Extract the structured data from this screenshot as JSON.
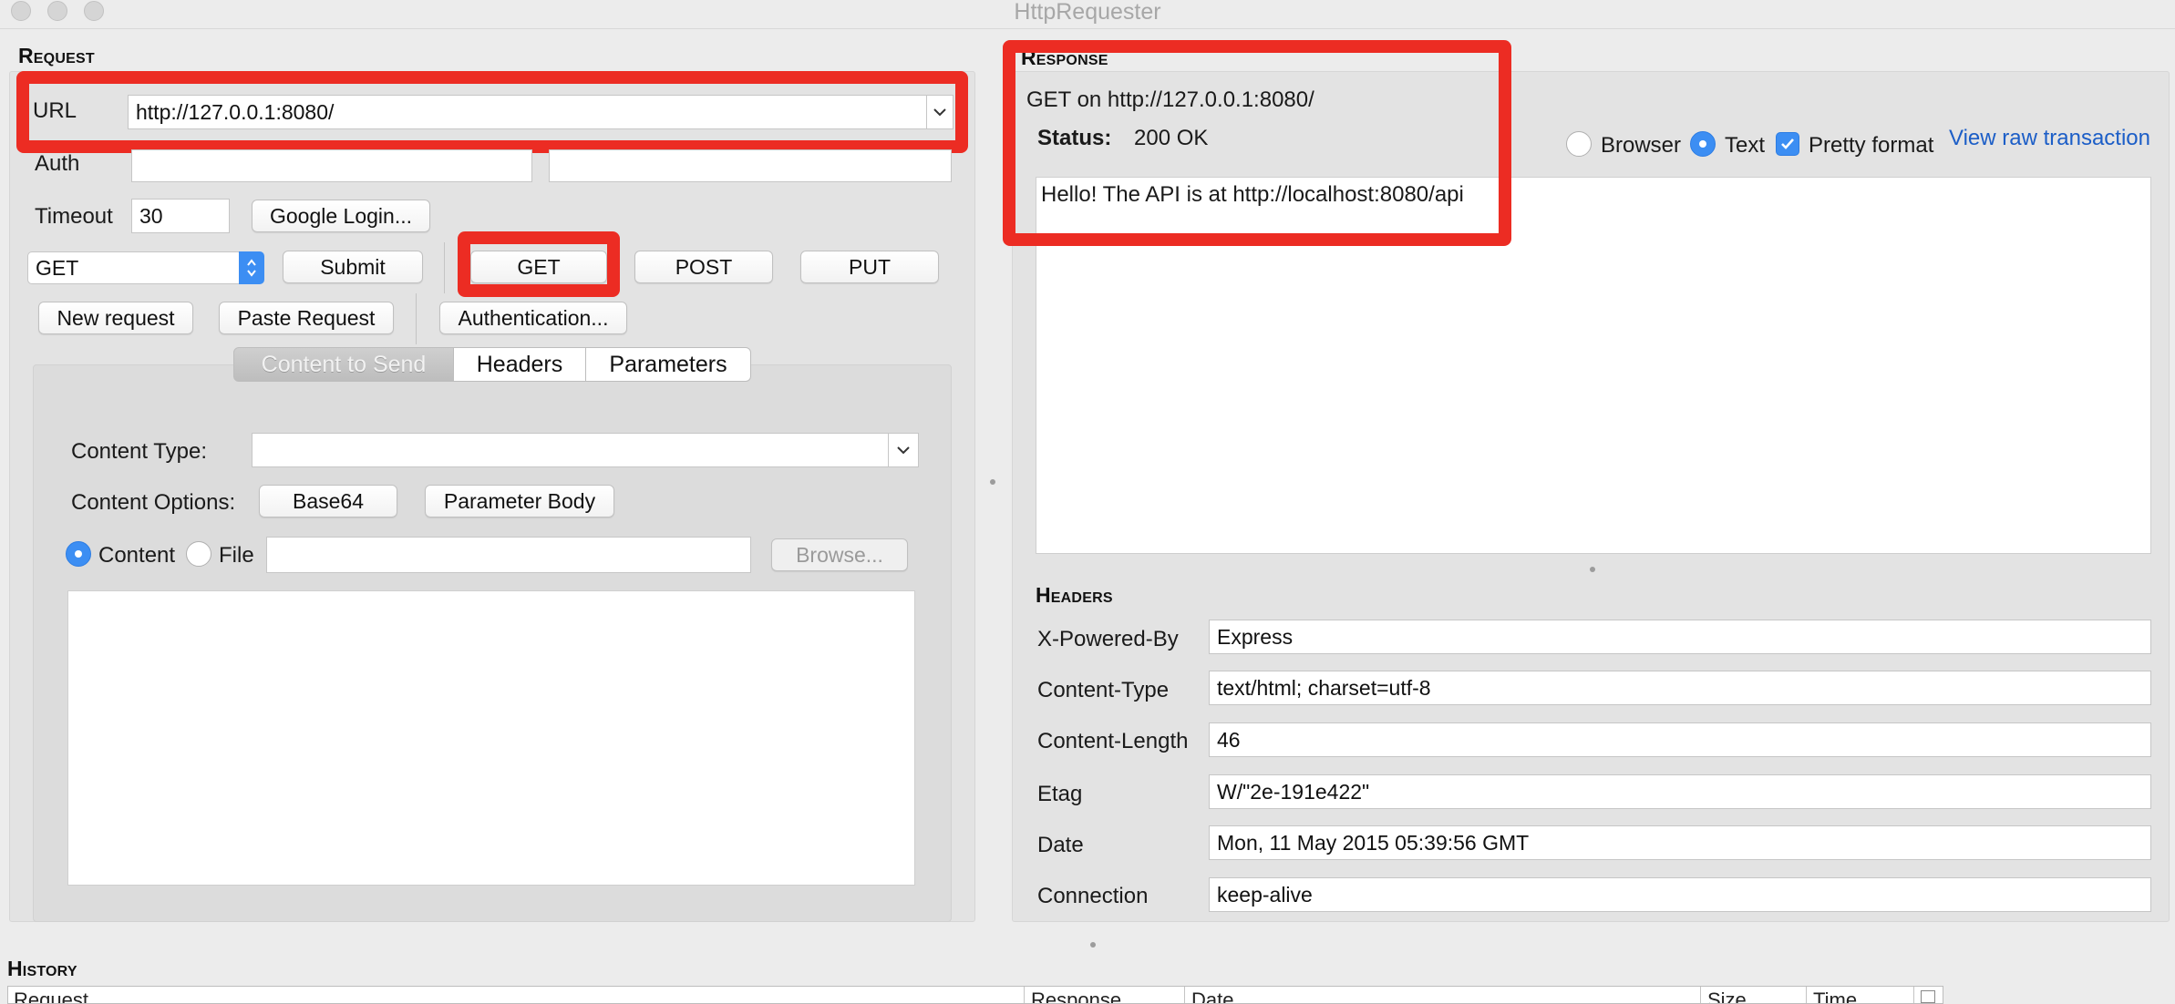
{
  "window": {
    "title": "HttpRequester"
  },
  "request": {
    "section_title": "Request",
    "url_label": "URL",
    "url_value": "http://127.0.0.1:8080/",
    "auth_label": "Auth",
    "auth_user": "",
    "auth_password": "",
    "timeout_label": "Timeout",
    "timeout_value": "30",
    "google_login": "Google Login...",
    "method_value": "GET",
    "submit": "Submit",
    "get": "GET",
    "post": "POST",
    "put": "PUT",
    "new_request": "New request",
    "paste_request": "Paste Request",
    "authentication": "Authentication...",
    "tabs": [
      "Content to Send",
      "Headers",
      "Parameters"
    ],
    "content_type_label": "Content Type:",
    "content_type_value": "",
    "content_options_label": "Content Options:",
    "base64": "Base64",
    "parameter_body": "Parameter Body",
    "content_radio": "Content",
    "file_radio": "File",
    "file_path": "",
    "browse": "Browse...",
    "body": ""
  },
  "response": {
    "section_title": "Response",
    "summary": "GET on http://127.0.0.1:8080/",
    "status_label": "Status:",
    "status_value": "200 OK",
    "view_options": {
      "browser": "Browser",
      "text": "Text",
      "pretty": "Pretty format",
      "selected": "Text",
      "pretty_checked": true
    },
    "view_raw": "View raw transaction",
    "body": "Hello! The API is at http://localhost:8080/api",
    "headers_title": "Headers",
    "headers": [
      {
        "name": "X-Powered-By",
        "value": "Express"
      },
      {
        "name": "Content-Type",
        "value": "text/html; charset=utf-8"
      },
      {
        "name": "Content-Length",
        "value": "46"
      },
      {
        "name": "Etag",
        "value": "W/\"2e-191e422\""
      },
      {
        "name": "Date",
        "value": "Mon, 11 May 2015 05:39:56 GMT"
      },
      {
        "name": "Connection",
        "value": "keep-alive"
      }
    ]
  },
  "history": {
    "section_title": "History",
    "columns": [
      "Request",
      "Response",
      "Date",
      "Size",
      "Time"
    ]
  },
  "colors": {
    "highlight": "#ec2c23",
    "accent": "#3c8ef3",
    "link": "#1c5ec7"
  }
}
